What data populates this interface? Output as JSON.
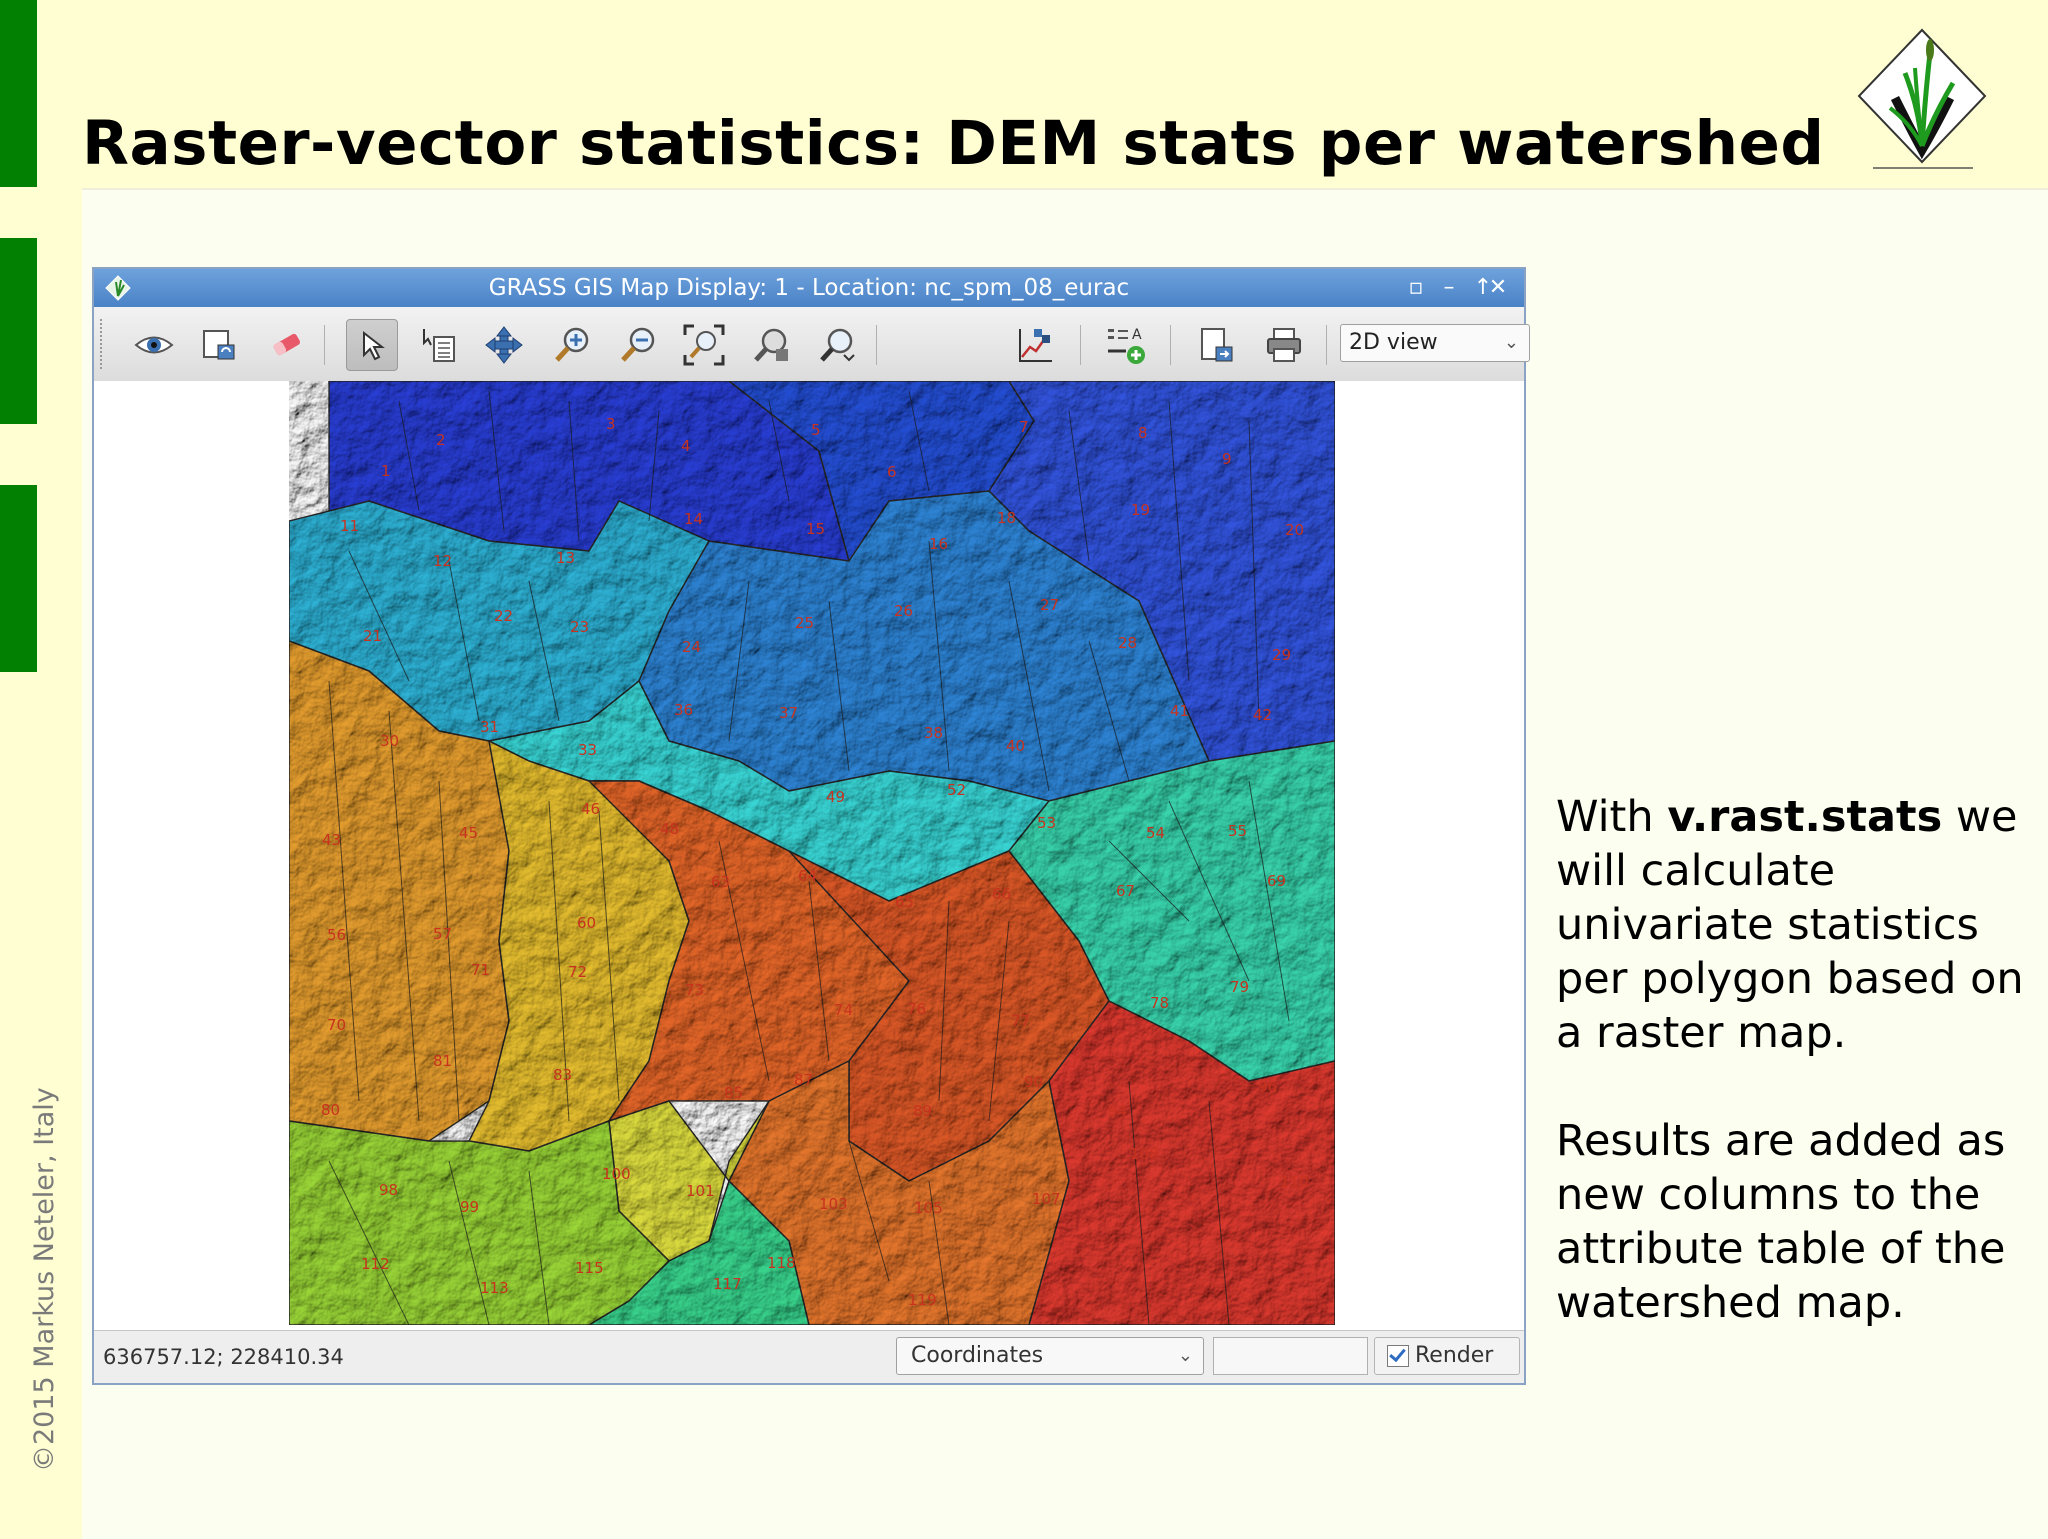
{
  "slide": {
    "title": "Raster-vector statistics: DEM stats per watershed",
    "copyright": "©2015 Markus Neteler, Italy"
  },
  "window": {
    "title": "GRASS GIS Map Display: 1  - Location: nc_spm_08_eurac",
    "controls": [
      "up-arrow",
      "minimize",
      "maximize",
      "close"
    ]
  },
  "toolbar": {
    "tools": [
      "eye-icon",
      "layers-render-icon",
      "erase-icon",
      "pointer-icon",
      "query-icon",
      "pan-icon",
      "zoom-in-icon",
      "zoom-out-icon",
      "zoom-extent-icon",
      "zoom-back-icon",
      "zoom-menu-icon",
      "analyze-icon",
      "overlay-icon",
      "save-display-icon",
      "print-icon"
    ],
    "view_mode": "2D view"
  },
  "map": {
    "labels": [
      "1",
      "2",
      "3",
      "4",
      "5",
      "6",
      "7",
      "8",
      "9",
      "11",
      "12",
      "13",
      "14",
      "15",
      "16",
      "18",
      "19",
      "20",
      "21",
      "22",
      "23",
      "24",
      "25",
      "26",
      "27",
      "28",
      "29",
      "30",
      "31",
      "33",
      "36",
      "37",
      "38",
      "40",
      "41",
      "42",
      "43",
      "45",
      "46",
      "48",
      "49",
      "52",
      "53",
      "54",
      "55",
      "56",
      "57",
      "60",
      "63",
      "64",
      "65",
      "66",
      "67",
      "69",
      "70",
      "71",
      "72",
      "73",
      "74",
      "76",
      "77",
      "78",
      "79",
      "80",
      "81",
      "83",
      "85",
      "87",
      "89",
      "90",
      "94",
      "96",
      "98",
      "99",
      "100",
      "101",
      "103",
      "105",
      "107",
      "108",
      "110",
      "112",
      "113",
      "115",
      "117",
      "118",
      "119"
    ]
  },
  "statusbar": {
    "coordinates": "636757.12; 228410.34",
    "mode": "Coordinates",
    "render_label": "Render",
    "render_checked": true
  },
  "description": {
    "p1_prefix": "With ",
    "p1_bold": "v.rast.stats",
    "p1_suffix": " we will calculate univariate statistics per polygon based on a raster map.",
    "p2": "Results are added as new columns to the attribute table of the watershed map."
  },
  "colors": {
    "sidebar_green": "#028001",
    "background": "#fefed2",
    "titlebar_blue": "#4a82c6"
  }
}
